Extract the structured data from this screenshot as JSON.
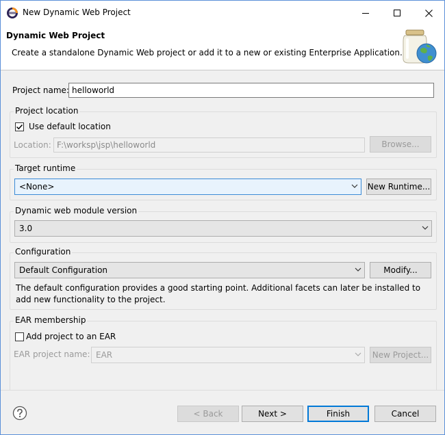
{
  "window": {
    "title": "New Dynamic Web Project"
  },
  "banner": {
    "title": "Dynamic Web Project",
    "description": "Create a standalone Dynamic Web project or add it to a new or existing Enterprise Application."
  },
  "project_name": {
    "label": "Project name:",
    "value": "helloworld"
  },
  "project_location": {
    "group_label": "Project location",
    "use_default_label": "Use default location",
    "use_default_checked": true,
    "location_label": "Location:",
    "location_value": "F:\\worksp\\jsp\\helloworld",
    "browse_label": "Browse..."
  },
  "target_runtime": {
    "group_label": "Target runtime",
    "selected": "<None>",
    "new_runtime_label": "New Runtime..."
  },
  "module_version": {
    "group_label": "Dynamic web module version",
    "selected": "3.0"
  },
  "configuration": {
    "group_label": "Configuration",
    "selected": "Default Configuration",
    "modify_label": "Modify...",
    "description": "The default configuration provides a good starting point. Additional facets can later be installed to add new functionality to the project."
  },
  "ear_membership": {
    "group_label": "EAR membership",
    "add_label": "Add project to an EAR",
    "add_checked": false,
    "ear_name_label": "EAR project name:",
    "ear_name_value": "EAR",
    "new_project_label": "New Project..."
  },
  "footer": {
    "back_label": "< Back",
    "next_label": "Next >",
    "finish_label": "Finish",
    "cancel_label": "Cancel"
  },
  "colors": {
    "accent": "#0078d7",
    "window_border": "#5a8fd8",
    "background": "#f0f0f0"
  }
}
